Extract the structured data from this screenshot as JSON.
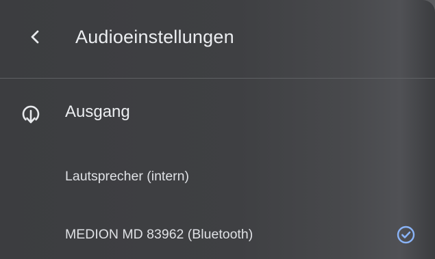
{
  "header": {
    "title": "Audioeinstellungen",
    "back_icon": "chevron-left-icon"
  },
  "output_section": {
    "title": "Ausgang",
    "icon": "audio-output-icon"
  },
  "devices": [
    {
      "label": "Lautsprecher (intern)",
      "selected": false
    },
    {
      "label": "MEDION MD 83962 (Bluetooth)",
      "selected": true
    }
  ],
  "colors": {
    "accent": "#8ab4f8",
    "text": "#e8eaed",
    "background": "#3e3f42"
  }
}
